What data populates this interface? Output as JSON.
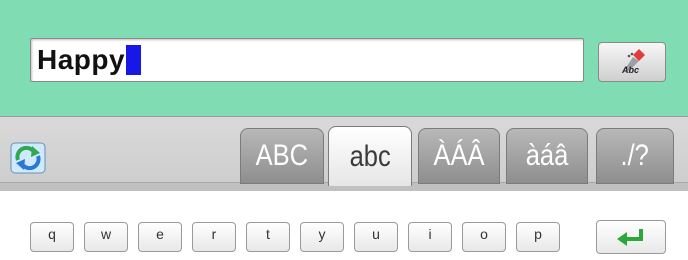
{
  "input": {
    "value": "Happy"
  },
  "font_button": {
    "label": "Abc",
    "icon": "pen-tip-icon",
    "accent": "#e23b3b"
  },
  "toolbar": {
    "swap_icon": "swap-arrows-icon",
    "tabs": [
      {
        "label": "ABC",
        "active": false
      },
      {
        "label": "abc",
        "active": true
      },
      {
        "label": "ÀÁÂ",
        "active": false
      },
      {
        "label": "àáâ",
        "active": false
      },
      {
        "label": "./?",
        "active": false
      }
    ]
  },
  "keyboard": {
    "row1": [
      "q",
      "w",
      "e",
      "r",
      "t",
      "y",
      "u",
      "i",
      "o",
      "p"
    ],
    "enter_icon": "return-arrow-icon"
  },
  "colors": {
    "panel_bg": "#7fdcb3",
    "cursor": "#1717e6",
    "swap_icon_green": "#2fa84f",
    "swap_icon_blue": "#2a78d6",
    "enter_icon_green": "#2aa83c"
  }
}
